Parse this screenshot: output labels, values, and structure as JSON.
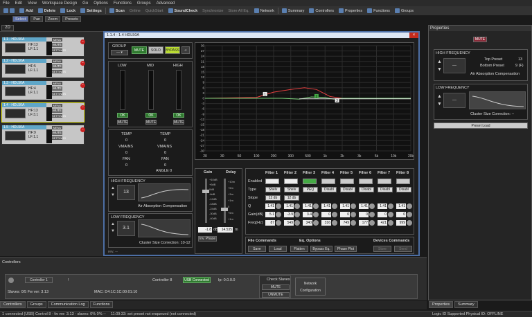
{
  "menu": [
    "File",
    "Edit",
    "View",
    "Workspace Design",
    "Go",
    "Options",
    "Functions",
    "Groups",
    "Advanced"
  ],
  "toolbar": [
    "Add",
    "Delete",
    "Lock",
    "Settings",
    "Scan",
    "Online",
    "QuickStart",
    "SoundCheck",
    "Synchronize",
    "Store All Eq.",
    "Network",
    "Summary",
    "Controllers",
    "Properties",
    "Functions",
    "Groups"
  ],
  "toolbar2": [
    "Select",
    "Pan",
    "Zoom",
    "Presets"
  ],
  "tab2d": "2D",
  "devices": [
    {
      "name": "1.1 - HDL50A",
      "hf": "HF:13",
      "lf": "LF:1.1"
    },
    {
      "name": "1.2 - HDL50A",
      "hf": "HF:5",
      "lf": "LF:1.1"
    },
    {
      "name": "1.3 - HDL50A",
      "hf": "HF:4",
      "lf": "LF:1.1"
    },
    {
      "name": "1.4 - HDL50A",
      "hf": "HF:13",
      "lf": "LF:3.1"
    },
    {
      "name": "1.5 - HDL50A",
      "hf": "HF:9",
      "lf": "LF:1.1"
    }
  ],
  "devlabels": {
    "menu": "MENU",
    "mute": "MUTE",
    "settings": "SETTINGS"
  },
  "window": {
    "title": "1.1.4 - 1.4 HDL50A",
    "close": "×"
  },
  "group": {
    "label": "GROUP",
    "mute": "MUTE",
    "solo": "SOLO",
    "bypass": "BYPASS"
  },
  "meters": {
    "low": "LOW",
    "mid": "MID",
    "high": "HIGH",
    "ok": "OK",
    "mute": "MUTE"
  },
  "temps": {
    "temp": "TEMP",
    "vmains": "VMAINS",
    "fan": "FAN",
    "zero": "0",
    "angle": "ANGLE 0"
  },
  "hf": {
    "title": "HIGH FREQUENCY",
    "value": "13",
    "sub": "Air Absorption Compensation"
  },
  "lf": {
    "title": "LOW FREQUENCY",
    "value": "3.1",
    "sub": "Cluster Size Correction:",
    "subv": "10-12"
  },
  "rev": "rev. --",
  "chart_data": {
    "type": "line",
    "x": [
      "20",
      "30",
      "50",
      "100",
      "200",
      "300",
      "500",
      "1k",
      "2k",
      "3k",
      "5k",
      "10k",
      "20k"
    ],
    "ylim": [
      -30,
      30
    ],
    "yticks": [
      "30",
      "27",
      "24",
      "21",
      "18",
      "15",
      "12",
      "9",
      "6",
      "3",
      "0",
      "-3",
      "-6",
      "-9",
      "-12",
      "-15",
      "-18",
      "-21",
      "-24",
      "-27",
      "-30"
    ],
    "markers": [
      "1",
      "2",
      "3"
    ]
  },
  "gain": {
    "title": "Gain",
    "ticks": [
      "+10dB",
      "+6dB",
      "0dB",
      "-6dB",
      "-12dB",
      "-18dB",
      "-24dB",
      "-30dB",
      "-40dB"
    ],
    "value": "-1.8",
    "unit": "dB",
    "inv": "Inv. Phase"
  },
  "delay": {
    "title": "Delay",
    "ticks": [
      "+10m",
      "+5m",
      "+3m",
      "+1m",
      "0",
      "+5m",
      "+1m"
    ],
    "value": "14.535",
    "unit": "m"
  },
  "filters": {
    "headers": [
      "Filter 1",
      "Filter 2",
      "Filter 3",
      "Filter 4",
      "Filter 5",
      "Filter 6",
      "Filter 7",
      "Filter 8"
    ],
    "enabled": "Enabled",
    "type": "Type",
    "slope": "Slope",
    "q": "Q",
    "gain": "Gain(dB)",
    "freq": "Freq(Hz)",
    "types": [
      "Shelv",
      "Shelv",
      "PEQ",
      "Disabl",
      "Disabl",
      "Disabl",
      "Disabl",
      "Disabl"
    ],
    "slopes": [
      "12 db",
      "12 db"
    ],
    "qv": [
      "1.41",
      "1.41",
      "1.41",
      "1.41",
      "1.41",
      "1.41",
      "1.41",
      "1.41"
    ],
    "gv": [
      "5.1",
      "-3.9",
      "3.4",
      "0",
      "0",
      "0",
      "0",
      "0"
    ],
    "fv": [
      "87",
      "549",
      "340",
      "316",
      "749",
      "177",
      "421",
      "999"
    ]
  },
  "fileCmd": {
    "title": "File Commands",
    "save": "Save",
    "load": "Load"
  },
  "eqOpt": {
    "title": "Eq. Options",
    "flatten": "Flatten",
    "bypass": "Bypass Eq.",
    "phase": "Phase Plot"
  },
  "devCmd": {
    "title": "Devices Commands",
    "store": "Store",
    "send": "Send"
  },
  "controllers": {
    "title": "Controllers",
    "sel": "Controller 1",
    "name": "Controller 8",
    "usb": "USB Connected",
    "slaves": "Slaves: 0/5  Fw ver: 3.13",
    "mac": "MAC: D4:1C:1C:00:01:10",
    "check": "Check Slaves",
    "mute": "MUTE",
    "unmute": "UNMUTE",
    "net": "Network Configuration",
    "ip": "Ip: 0.0.0.0"
  },
  "btabs": [
    "Controllers",
    "Groups",
    "Communication Log",
    "Functions"
  ],
  "props": {
    "title": "Properties",
    "mute": "MUTE",
    "hf": "HIGH FREQUENCY",
    "top": "Top Preset",
    "topv": "13",
    "bottom": "Bottom Preset",
    "bottomv": "9 (F)",
    "air": "Air Absorption Compensation",
    "lf": "LOW FREQUENCY",
    "cluster": "Cluster Size Correction: --",
    "load": "Preset Load",
    "dash": "---"
  },
  "ptabs": [
    "Properties",
    "Summary"
  ],
  "status": {
    "left": "1 connected (USB) Control 8 - fw ver: 3.13 - slaves: 0% 0% --",
    "mid": "11:09:33: set preset not enqueued (not connected)",
    "right": "Logic ID Supported    Physical ID: OFFLINE"
  }
}
